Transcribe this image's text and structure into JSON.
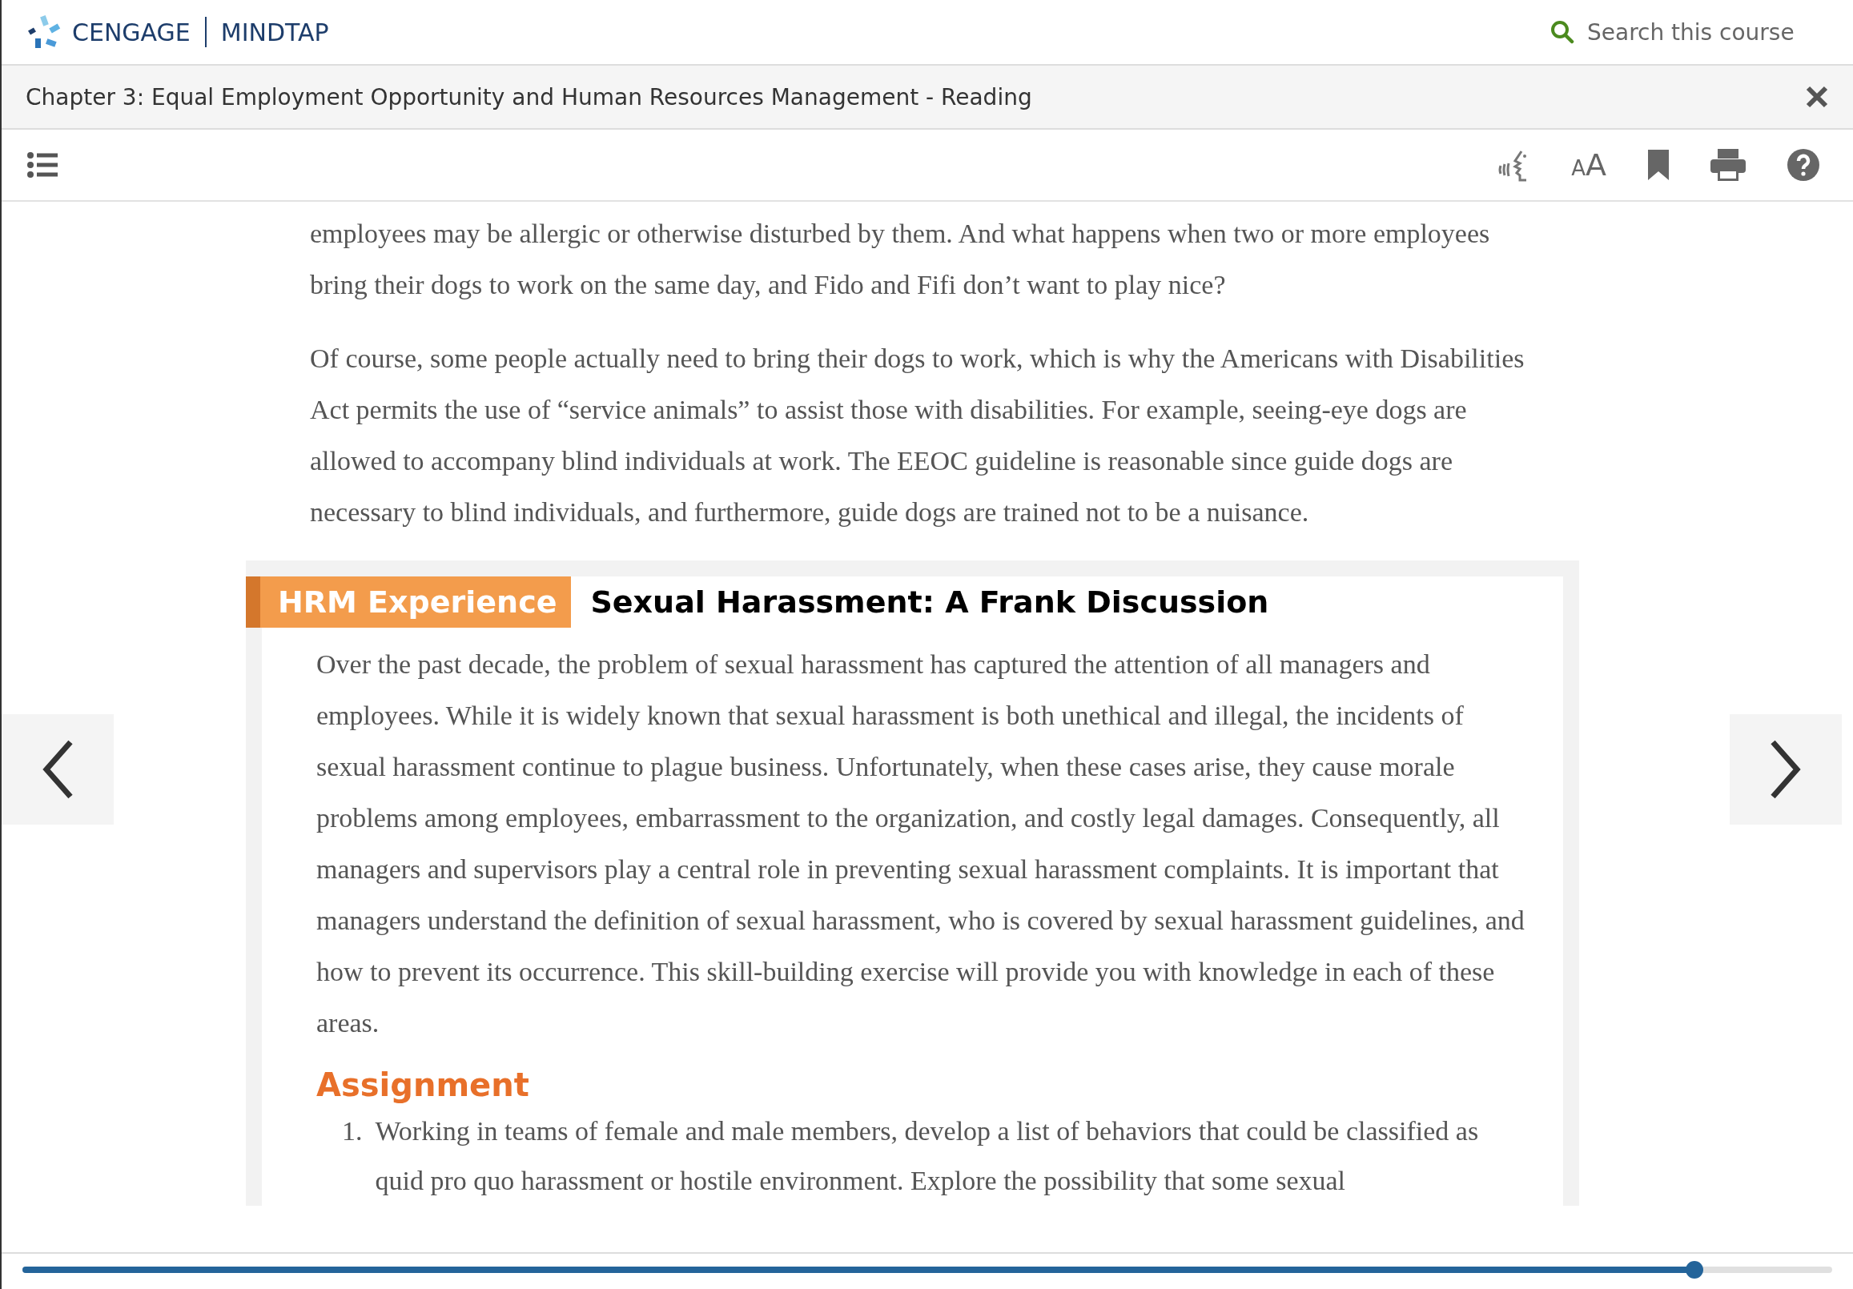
{
  "brand": {
    "company": "CENGAGE",
    "product": "MINDTAP"
  },
  "search": {
    "placeholder": "Search this course"
  },
  "title_bar": {
    "title": "Chapter 3: Equal Employment Opportunity and Human Resources Management - Reading"
  },
  "toolbar": {
    "text_size_letters": [
      "A",
      "A"
    ]
  },
  "reading": {
    "paragraphs": [
      "employees may be allergic or otherwise disturbed by them. And what happens when two or more employees bring their dogs to work on the same day, and Fido and Fifi don’t want to play nice?",
      "Of course, some people actually need to bring their dogs to work, which is why the Americans with Disabilities Act permits the use of “service animals” to assist those with disabilities. For example, seeing-eye dogs are allowed to accompany blind individuals at work. The EEOC guideline is reasonable since guide dogs are necessary to blind individuals, and furthermore, guide dogs are trained not to be a nuisance."
    ],
    "feature": {
      "label": "HRM Experience",
      "title": "Sexual Harassment: A Frank Discussion",
      "paragraphs": [
        "Over the past decade, the problem of sexual harassment has captured the attention of all managers and employees. While it is widely known that sexual harassment is both unethical and illegal, the incidents of sexual harassment continue to plague business. Unfortunately, when these cases arise, they cause morale problems among employees, embarrassment to the organization, and costly legal damages. Consequently, all managers and supervisors play a central role in preventing sexual harassment complaints. It is important that managers understand the definition of sexual harassment, who is covered by sexual harassment guidelines, and how to prevent its occurrence. This skill-building exercise will provide you with knowledge in each of these areas."
      ],
      "section_heading": "Assignment",
      "list": [
        {
          "number": "1.",
          "text": "Working in teams of female and male members, develop a list of behaviors that could be classified as quid pro quo harassment or hostile environment. Explore the possibility that some sexual"
        }
      ]
    }
  },
  "progress": {
    "level": 0.924
  }
}
